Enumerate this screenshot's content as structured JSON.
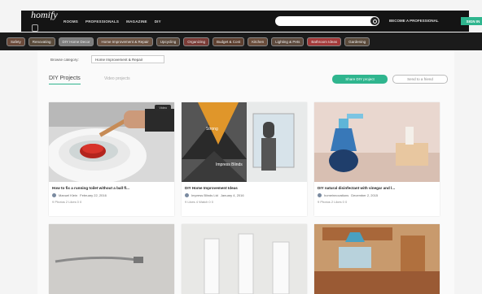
{
  "header": {
    "logo": "homify",
    "nav": [
      "ROOMS",
      "PROFESSIONALS",
      "MAGAZINE",
      "DIY"
    ],
    "search_placeholder": "",
    "become_pro": "BECOME A PROFESSIONAL",
    "signin": "SIGN IN"
  },
  "categories": [
    {
      "label": "Safety",
      "color": "#6b4a3a"
    },
    {
      "label": "Renovating",
      "color": "#5a4b3b"
    },
    {
      "label": "DIY Home Decor",
      "color": "#7d7d7d"
    },
    {
      "label": "Home Improvement & Repair",
      "color": "#6e5544"
    },
    {
      "label": "Upcycling",
      "color": "#5c4a3c"
    },
    {
      "label": "Organizing",
      "color": "#7a3b36"
    },
    {
      "label": "Budget & Cost",
      "color": "#5e4030"
    },
    {
      "label": "Kitchen",
      "color": "#6a4d3b"
    },
    {
      "label": "Lighting & Pets",
      "color": "#5d4a3d"
    },
    {
      "label": "Bathroom Ideas",
      "color": "#a43a3a"
    },
    {
      "label": "Gardening",
      "color": "#5a4a3b"
    }
  ],
  "browse": {
    "label": "Browse category:",
    "value": "Home Improvement & Repair"
  },
  "tabs": {
    "active": "DIY Projects",
    "other": "Video projects"
  },
  "buttons": {
    "new_project": "Share DIY project",
    "subscribe": "Send to a friend"
  },
  "cards": [
    {
      "title": "How to fix a running toilet without a ball fl...",
      "author": "Manuel Klein",
      "date": "February 22, 2016",
      "stats": "9 Photos  2 Likes  0 0",
      "badge": "Video"
    },
    {
      "title": "DIY Home Improvement Ideas",
      "author": "Impress Blinds Ltd",
      "date": "January 4, 2016",
      "stats": "9 Likes  4 Watch  0 0",
      "badge": ""
    },
    {
      "title": "DIY natural disinfectant with vinegar and l...",
      "author": "homeinnovations",
      "date": "December 2, 2015",
      "stats": "9 Photos  2 Likes  0 0",
      "badge": ""
    },
    {
      "title": "",
      "author": "",
      "date": "",
      "stats": "",
      "badge": ""
    },
    {
      "title": "",
      "author": "",
      "date": "",
      "stats": "",
      "badge": ""
    },
    {
      "title": "",
      "author": "",
      "date": "",
      "stats": "",
      "badge": ""
    }
  ],
  "overlay_text": {
    "impress": "Impress Blinds",
    "strong": "Strong"
  },
  "colors": {
    "accent": "#2fb58e",
    "header": "#141414"
  }
}
